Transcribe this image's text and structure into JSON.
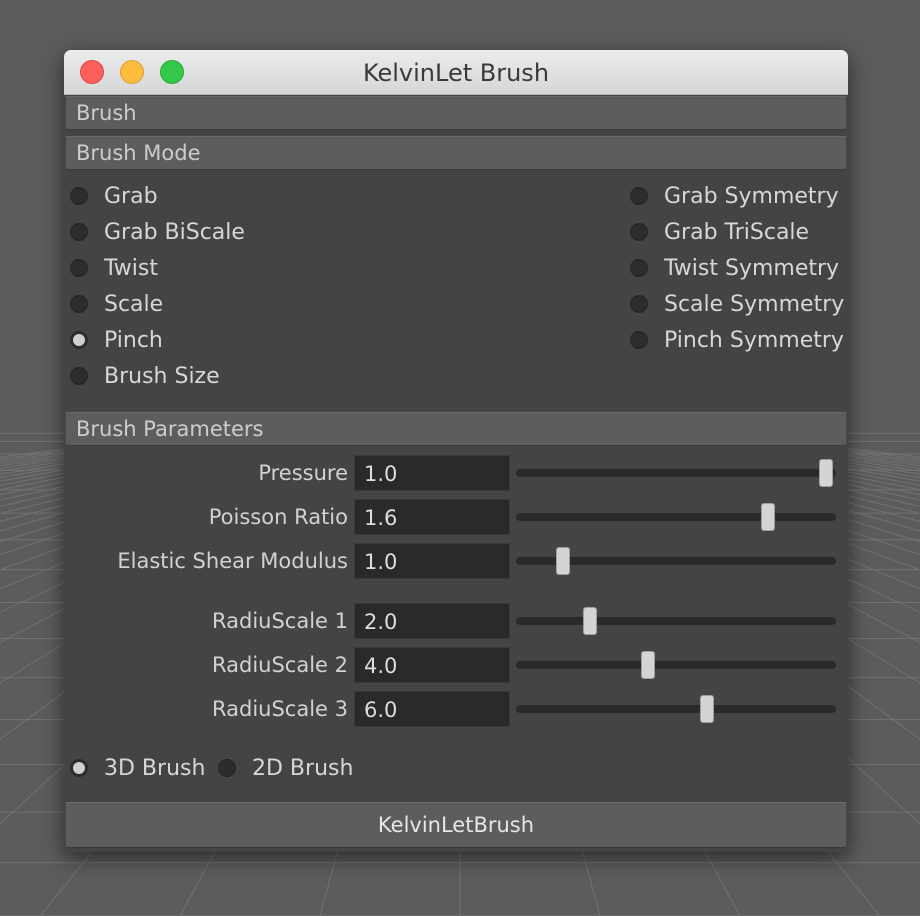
{
  "window": {
    "title": "KelvinLet Brush"
  },
  "sections": {
    "brush": "Brush",
    "brush_mode": "Brush Mode",
    "brush_parameters": "Brush Parameters"
  },
  "brush_modes": {
    "left": [
      {
        "label": "Grab",
        "checked": false
      },
      {
        "label": "Grab BiScale",
        "checked": false
      },
      {
        "label": "Twist",
        "checked": false
      },
      {
        "label": "Scale",
        "checked": false
      },
      {
        "label": "Pinch",
        "checked": true
      },
      {
        "label": "Brush Size",
        "checked": false
      }
    ],
    "right": [
      {
        "label": "Grab Symmetry",
        "checked": false
      },
      {
        "label": "Grab TriScale",
        "checked": false
      },
      {
        "label": "Twist Symmetry",
        "checked": false
      },
      {
        "label": "Scale Symmetry",
        "checked": false
      },
      {
        "label": "Pinch Symmetry",
        "checked": false
      }
    ]
  },
  "parameters": [
    {
      "label": "Pressure",
      "value": "1.0",
      "slider_fraction": 0.99
    },
    {
      "label": "Poisson Ratio",
      "value": "1.6",
      "slider_fraction": 0.8
    },
    {
      "label": "Elastic Shear Modulus",
      "value": "1.0",
      "slider_fraction": 0.13
    },
    {
      "label": "RadiuScale 1",
      "value": "2.0",
      "slider_fraction": 0.22
    },
    {
      "label": "RadiuScale 2",
      "value": "4.0",
      "slider_fraction": 0.41
    },
    {
      "label": "RadiuScale 3",
      "value": "6.0",
      "slider_fraction": 0.6
    }
  ],
  "dimension_mode": [
    {
      "label": "3D Brush",
      "checked": true
    },
    {
      "label": "2D Brush",
      "checked": false
    }
  ],
  "action_button": "KelvinLetBrush",
  "colors": {
    "panel": "#444444",
    "section_header": "#5d5d5d",
    "field": "#2a2a2a",
    "close": "#fc605c",
    "minimize": "#fdbc40",
    "maximize": "#34c84a"
  }
}
